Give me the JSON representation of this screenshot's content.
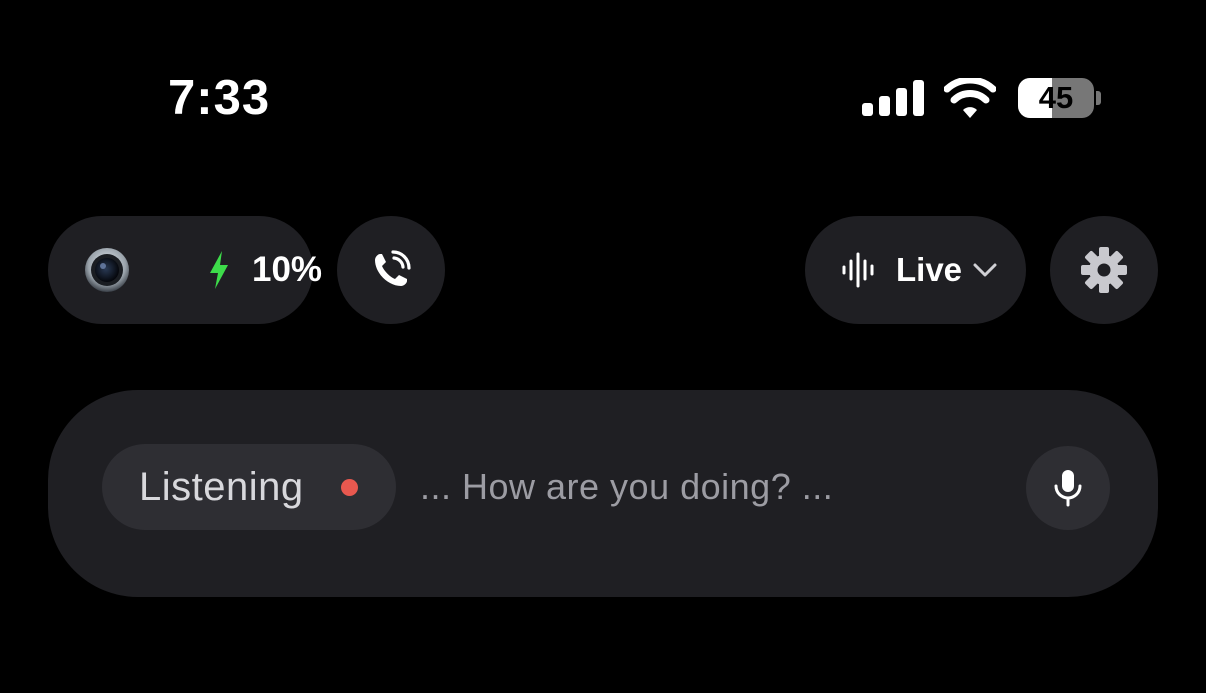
{
  "status_bar": {
    "time": "7:33",
    "battery_level": "45",
    "battery_fraction": 0.45,
    "icons": [
      "cellular-signal-icon",
      "wifi-icon",
      "battery-icon"
    ]
  },
  "device": {
    "icon": "camera-lens-icon",
    "charging_icon": "bolt-icon",
    "charging_color": "#3ddc4a",
    "battery_percent": "10%"
  },
  "call_button": {
    "icon": "phone-call-icon"
  },
  "mode_selector": {
    "icon": "waveform-icon",
    "label": "Live",
    "dropdown_icon": "chevron-down-icon"
  },
  "settings_button": {
    "icon": "gear-icon"
  },
  "listening_bar": {
    "status_label": "Listening",
    "status_dot_color": "#e8584f",
    "transcript": "... How are you doing? ...",
    "mic_icon": "microphone-icon"
  },
  "colors": {
    "background": "#000000",
    "surface": "#1f1f23",
    "surface_raised": "#2e2e33"
  }
}
